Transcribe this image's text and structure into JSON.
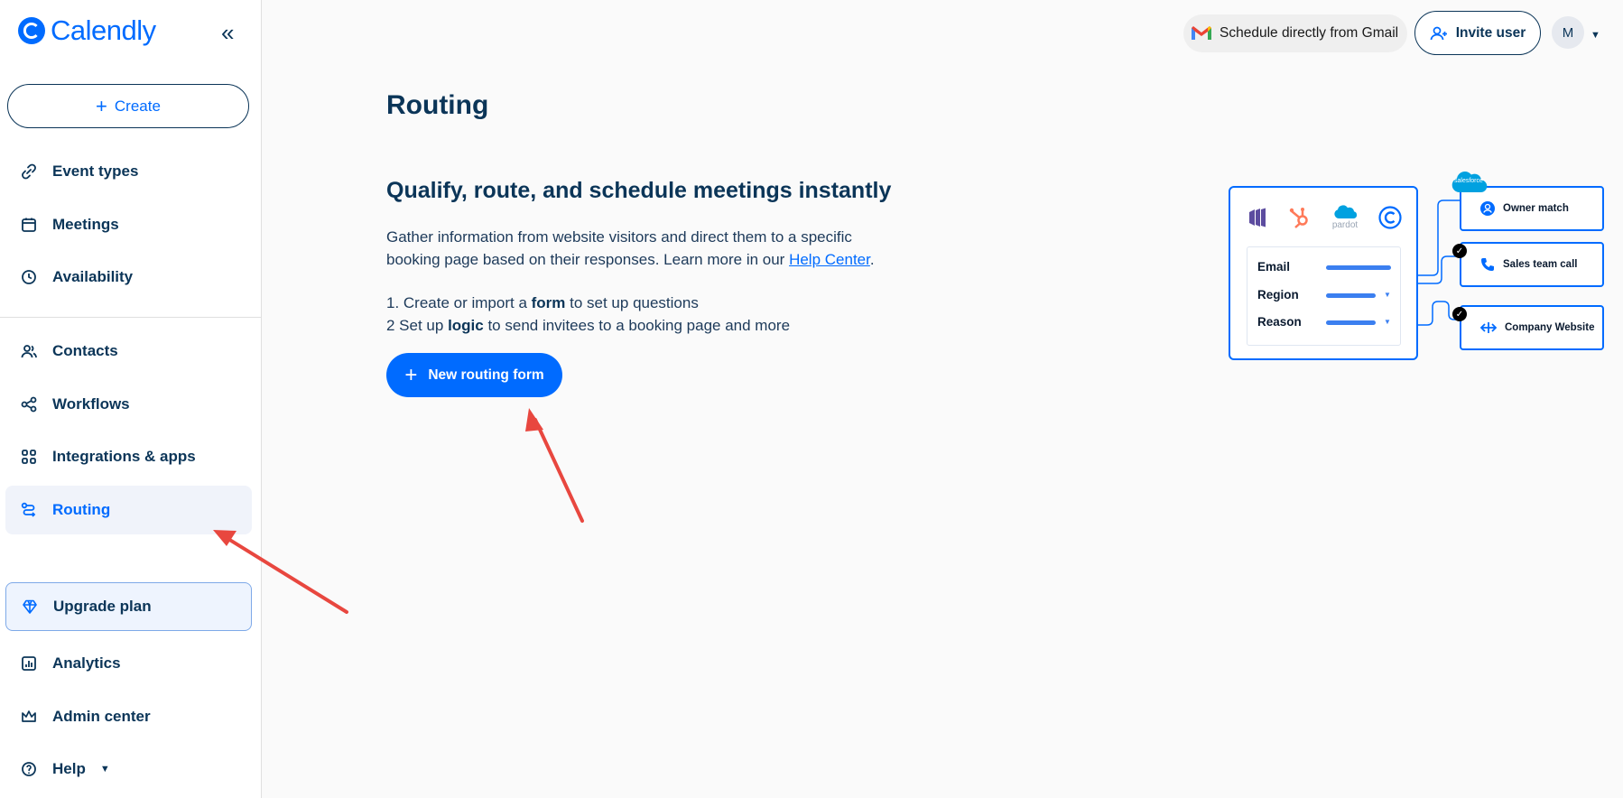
{
  "app": {
    "name": "Calendly"
  },
  "sidebar": {
    "create_label": "Create",
    "items": [
      {
        "id": "event-types",
        "label": "Event types"
      },
      {
        "id": "meetings",
        "label": "Meetings"
      },
      {
        "id": "availability",
        "label": "Availability"
      },
      {
        "id": "contacts",
        "label": "Contacts"
      },
      {
        "id": "workflows",
        "label": "Workflows"
      },
      {
        "id": "integrations",
        "label": "Integrations & apps"
      },
      {
        "id": "routing",
        "label": "Routing",
        "active": true
      },
      {
        "id": "upgrade",
        "label": "Upgrade plan"
      },
      {
        "id": "analytics",
        "label": "Analytics"
      },
      {
        "id": "admin",
        "label": "Admin center"
      },
      {
        "id": "help",
        "label": "Help"
      }
    ]
  },
  "topbar": {
    "gmail_label": "Schedule directly from Gmail",
    "invite_label": "Invite user",
    "avatar_initial": "M"
  },
  "main": {
    "title": "Routing",
    "headline": "Qualify, route, and schedule meetings instantly",
    "description_prefix": "Gather information from website visitors and direct them to a specific booking page based on their responses. Learn more in our ",
    "help_link": "Help Center",
    "description_suffix": ".",
    "step1_prefix": "1. Create or import a ",
    "step1_bold": "form",
    "step1_suffix": " to set up questions",
    "step2_prefix": "2 Set up ",
    "step2_bold": "logic",
    "step2_suffix": " to send invitees to a booking page and more",
    "new_button": "New routing form"
  },
  "illustration": {
    "fields": [
      "Email",
      "Region",
      "Reason"
    ],
    "routes": [
      "Owner match",
      "Sales team call",
      "Company Website"
    ],
    "salesforce_label": "salesforce",
    "pardot_label": "pardot"
  },
  "colors": {
    "accent": "#006bff",
    "navy": "#0b3558",
    "annotation_arrow": "#e8473f"
  }
}
